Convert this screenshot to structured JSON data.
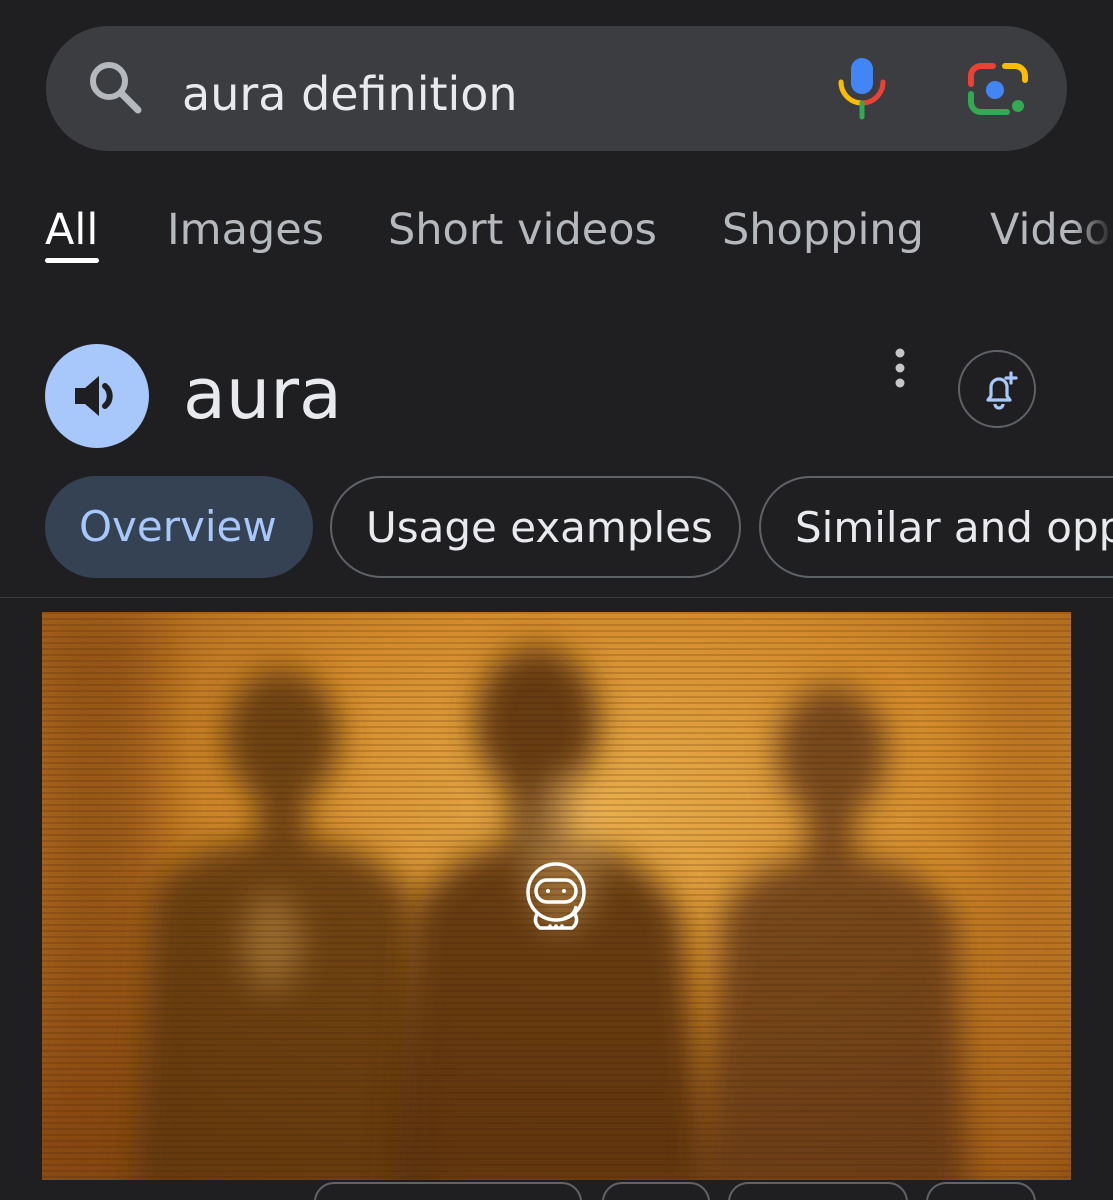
{
  "search": {
    "query": "aura definition"
  },
  "tabs": [
    {
      "label": "All",
      "active": true
    },
    {
      "label": "Images",
      "active": false
    },
    {
      "label": "Short videos",
      "active": false
    },
    {
      "label": "Shopping",
      "active": false
    },
    {
      "label": "Videos",
      "active": false
    }
  ],
  "header": {
    "word": "aura"
  },
  "chips": [
    {
      "label": "Overview",
      "selected": true
    },
    {
      "label": "Usage examples",
      "selected": false
    },
    {
      "label": "Similar and opposite words",
      "selected": false
    }
  ],
  "icons": {
    "search": "search-icon",
    "mic": "mic-icon",
    "lens": "lens-icon",
    "speaker": "speaker-icon",
    "more": "more-vert-icon",
    "bell": "bell-plus-icon",
    "badge": "robot-mascot-icon"
  },
  "colors": {
    "background": "#1f1f21",
    "search_bar": "#3c3d40",
    "accent": "#a8c7fa",
    "chip_selected_bg": "#344254",
    "image_tone": "#c98a2a"
  }
}
